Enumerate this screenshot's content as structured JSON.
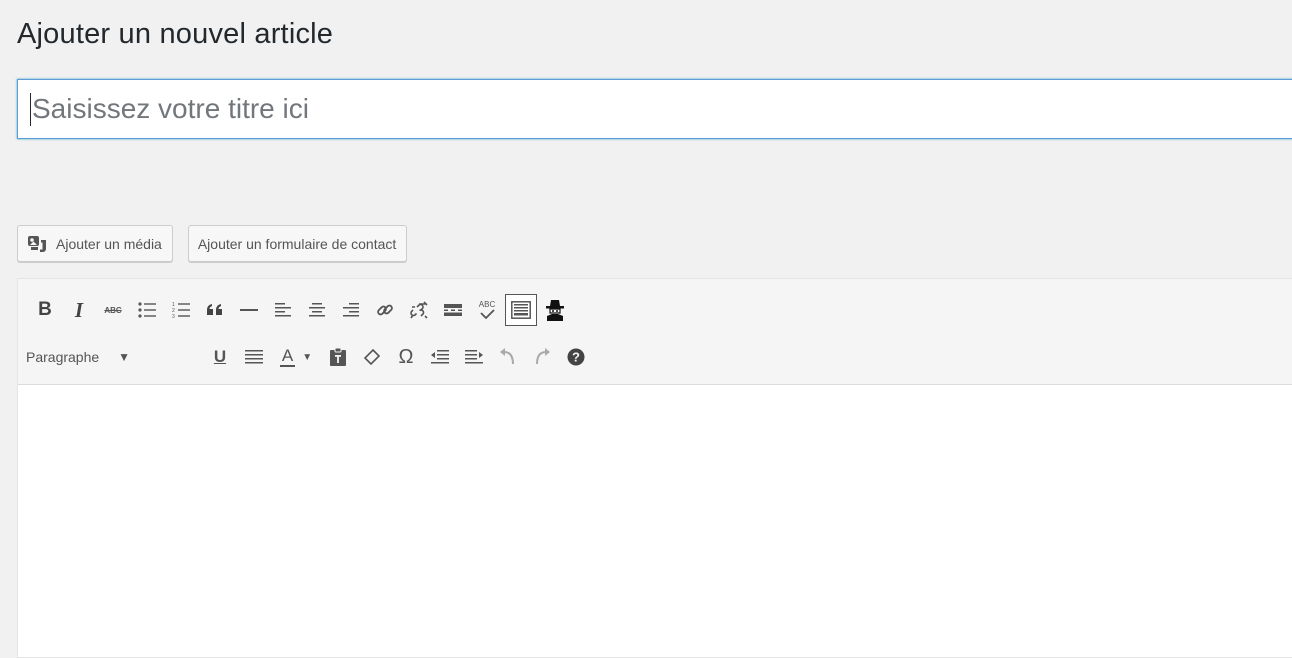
{
  "page": {
    "title": "Ajouter un nouvel article"
  },
  "title_field": {
    "placeholder": "Saisissez votre titre ici",
    "value": ""
  },
  "media_buttons": {
    "add_media": "Ajouter un média",
    "add_contact_form": "Ajouter un formulaire de contact"
  },
  "toolbar": {
    "row1": [
      "bold-icon",
      "italic-icon",
      "strikethrough-icon",
      "bullet-list-icon",
      "numbered-list-icon",
      "blockquote-icon",
      "horizontal-line-icon",
      "align-left-icon",
      "align-center-icon",
      "align-right-icon",
      "link-icon",
      "unlink-icon",
      "read-more-icon",
      "spellcheck-icon",
      "toolbar-toggle-icon",
      "spy-icon"
    ],
    "bold_label": "B",
    "italic_label": "I",
    "strike_label": "ABC",
    "spellcheck_label": "ABC",
    "format_select": "Paragraphe",
    "underline_label": "U",
    "text_color_label": "A",
    "special_char_label": "Ω",
    "row2": [
      "format-select",
      "underline-icon",
      "justify-icon",
      "text-color-icon",
      "paste-text-icon",
      "clear-formatting-icon",
      "special-character-icon",
      "outdent-icon",
      "indent-icon",
      "undo-icon",
      "redo-icon",
      "help-icon"
    ]
  },
  "colors": {
    "background": "#f1f1f1",
    "focus_border": "#5b9dd9",
    "icon": "#555555"
  }
}
